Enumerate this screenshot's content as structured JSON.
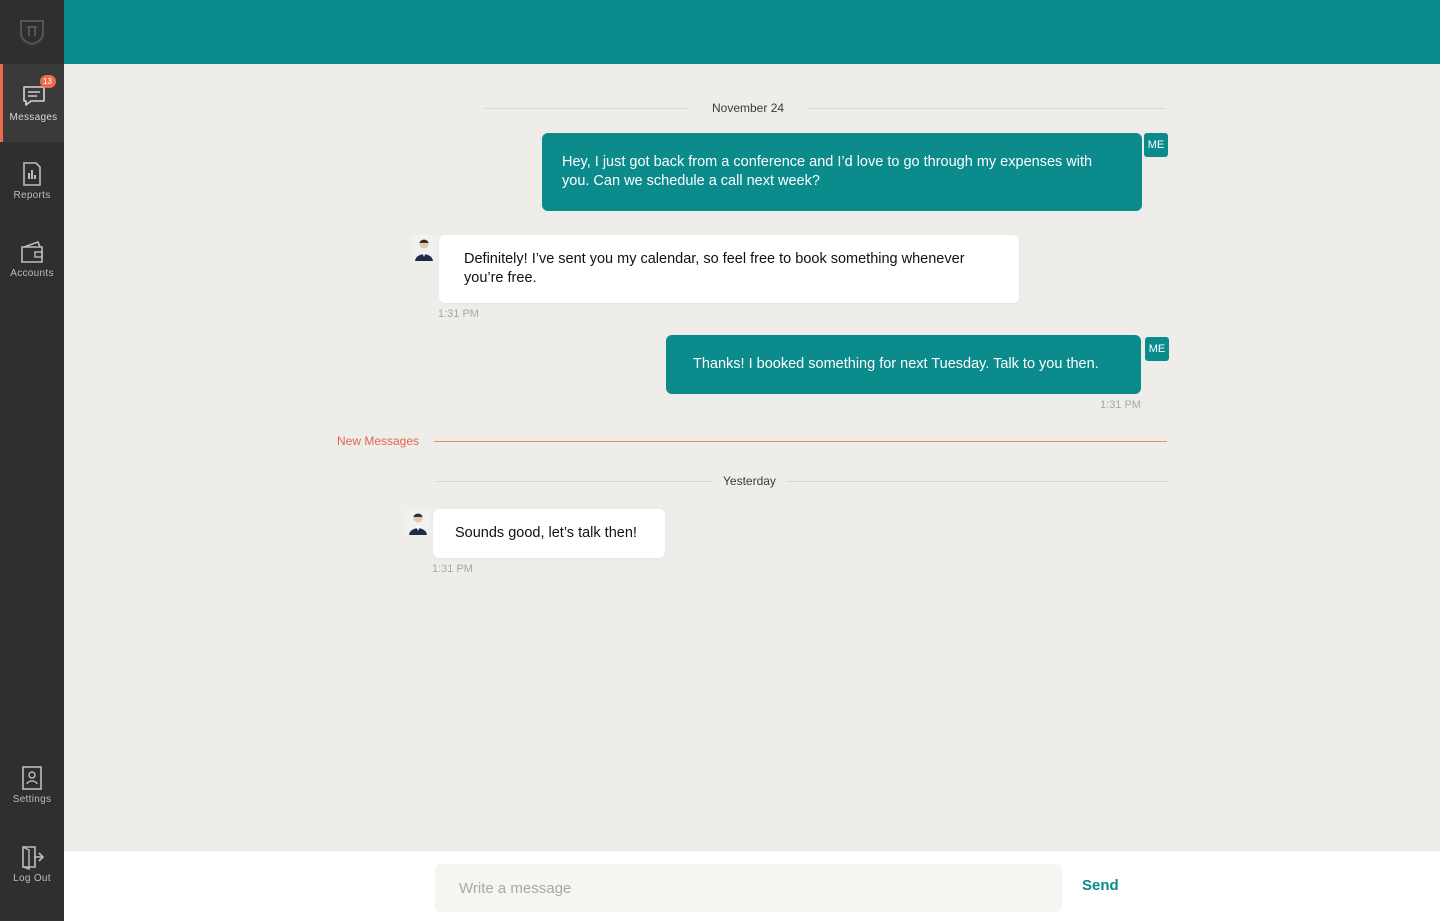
{
  "sidebar": {
    "messages": {
      "label": "Messages",
      "badge": "13"
    },
    "reports": {
      "label": "Reports"
    },
    "accounts": {
      "label": "Accounts"
    },
    "settings": {
      "label": "Settings"
    },
    "logout": {
      "label": "Log Out"
    }
  },
  "conversation": {
    "separators": [
      "November 24",
      "Yesterday"
    ],
    "new_messages_label": "New Messages",
    "me_tag": "ME",
    "messages": [
      {
        "from": "me",
        "text": "Hey, I just got back from a conference and I’d love to go through my expenses with you. Can we schedule a call next week?"
      },
      {
        "from": "them",
        "text": "Definitely! I’ve sent you my calendar, so feel free to book something whenever you’re free.",
        "time": "1:31 PM"
      },
      {
        "from": "me",
        "text": "Thanks! I booked something for next Tuesday. Talk to you then.",
        "time": "1:31 PM"
      },
      {
        "from": "them",
        "text": "Sounds good, let’s talk then!",
        "time": "1:31 PM"
      }
    ]
  },
  "composer": {
    "placeholder": "Write a message",
    "send_label": "Send"
  },
  "colors": {
    "accent": "#0b8b8c",
    "sidebar": "#2f2f2f",
    "alert": "#ee6a4a",
    "background": "#eeede9"
  }
}
